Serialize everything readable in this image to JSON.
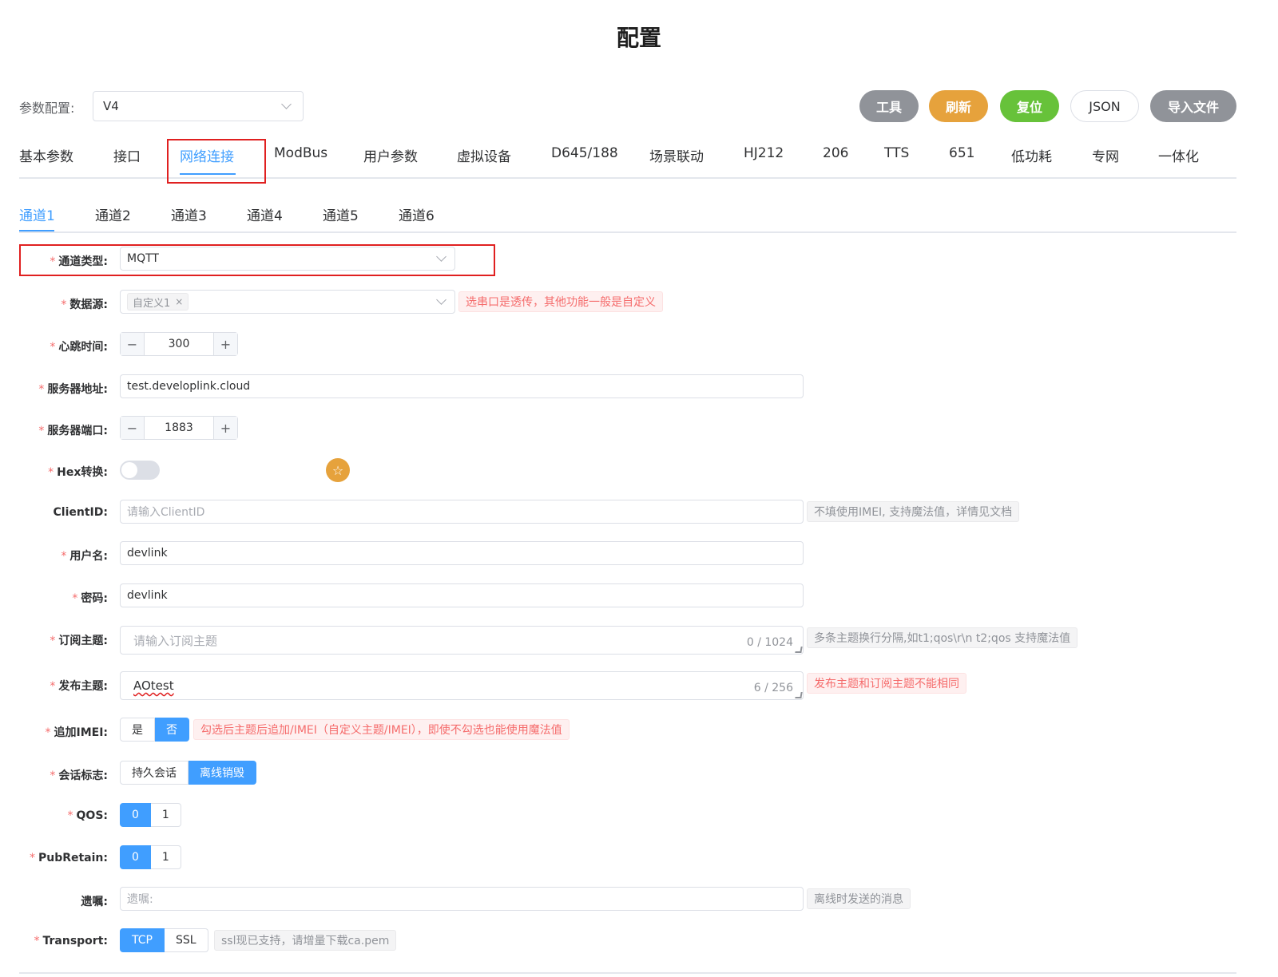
{
  "title": "配置",
  "param_config": {
    "label": "参数配置:",
    "value": "V4"
  },
  "toolbar": {
    "tools": "工具",
    "refresh": "刷新",
    "reset": "复位",
    "json": "JSON",
    "import": "导入文件"
  },
  "main_tabs": [
    "基本参数",
    "接口",
    "网络连接",
    "ModBus",
    "用户参数",
    "虚拟设备",
    "D645/188",
    "场景联动",
    "HJ212",
    "206",
    "TTS",
    "651",
    "低功耗",
    "专网",
    "一体化"
  ],
  "sub_tabs": [
    "通道1",
    "通道2",
    "通道3",
    "通道4",
    "通道5",
    "通道6"
  ],
  "form": {
    "channel_type": {
      "label": "通道类型:",
      "value": "MQTT"
    },
    "data_source": {
      "label": "数据源:",
      "tag": "自定义1",
      "tag_close": "×",
      "hint": "选串口是透传，其他功能一般是自定义"
    },
    "heartbeat": {
      "label": "心跳时间:",
      "value": "300",
      "minus": "−",
      "plus": "+"
    },
    "server_addr": {
      "label": "服务器地址:",
      "value": "test.developlink.cloud"
    },
    "server_port": {
      "label": "服务器端口:",
      "value": "1883",
      "minus": "−",
      "plus": "+"
    },
    "hex": {
      "label": "Hex转换:",
      "on": false
    },
    "client_id": {
      "label": "ClientID:",
      "placeholder": "请输入ClientID",
      "hint": "不填使用IMEI, 支持魔法值，详情见文档"
    },
    "username": {
      "label": "用户名:",
      "value": "devlink"
    },
    "password": {
      "label": "密码:",
      "value": "devlink"
    },
    "sub_topic": {
      "label": "订阅主题:",
      "placeholder": "请输入订阅主题",
      "count": "0 / 1024",
      "hint": "多条主题换行分隔,如t1;qos\\r\\n t2;qos 支持魔法值"
    },
    "pub_topic": {
      "label": "发布主题:",
      "value": "AOtest",
      "count": "6 / 256",
      "hint": "发布主题和订阅主题不能相同"
    },
    "append_imei": {
      "label": "追加IMEI:",
      "options": [
        "是",
        "否"
      ],
      "selected": "否",
      "hint": "勾选后主题后追加/IMEI（自定义主题/IMEI），即使不勾选也能使用魔法值"
    },
    "session": {
      "label": "会话标志:",
      "options": [
        "持久会话",
        "离线销毁"
      ],
      "selected": "离线销毁"
    },
    "qos": {
      "label": "QOS:",
      "options": [
        "0",
        "1"
      ],
      "selected": "0"
    },
    "pub_retain": {
      "label": "PubRetain:",
      "options": [
        "0",
        "1"
      ],
      "selected": "0"
    },
    "will": {
      "label": "遗嘱:",
      "placeholder": "遗嘱:",
      "hint": "离线时发送的消息"
    },
    "transport": {
      "label": "Transport:",
      "options": [
        "TCP",
        "SSL"
      ],
      "selected": "TCP",
      "hint": "ssl现已支持，请增量下载ca.pem"
    }
  },
  "colors": {
    "primary": "#409eff",
    "danger": "#f56c6c",
    "warning": "#e6a23c",
    "success": "#67c23a",
    "info": "#909399",
    "highlight_box": "#e02020"
  }
}
